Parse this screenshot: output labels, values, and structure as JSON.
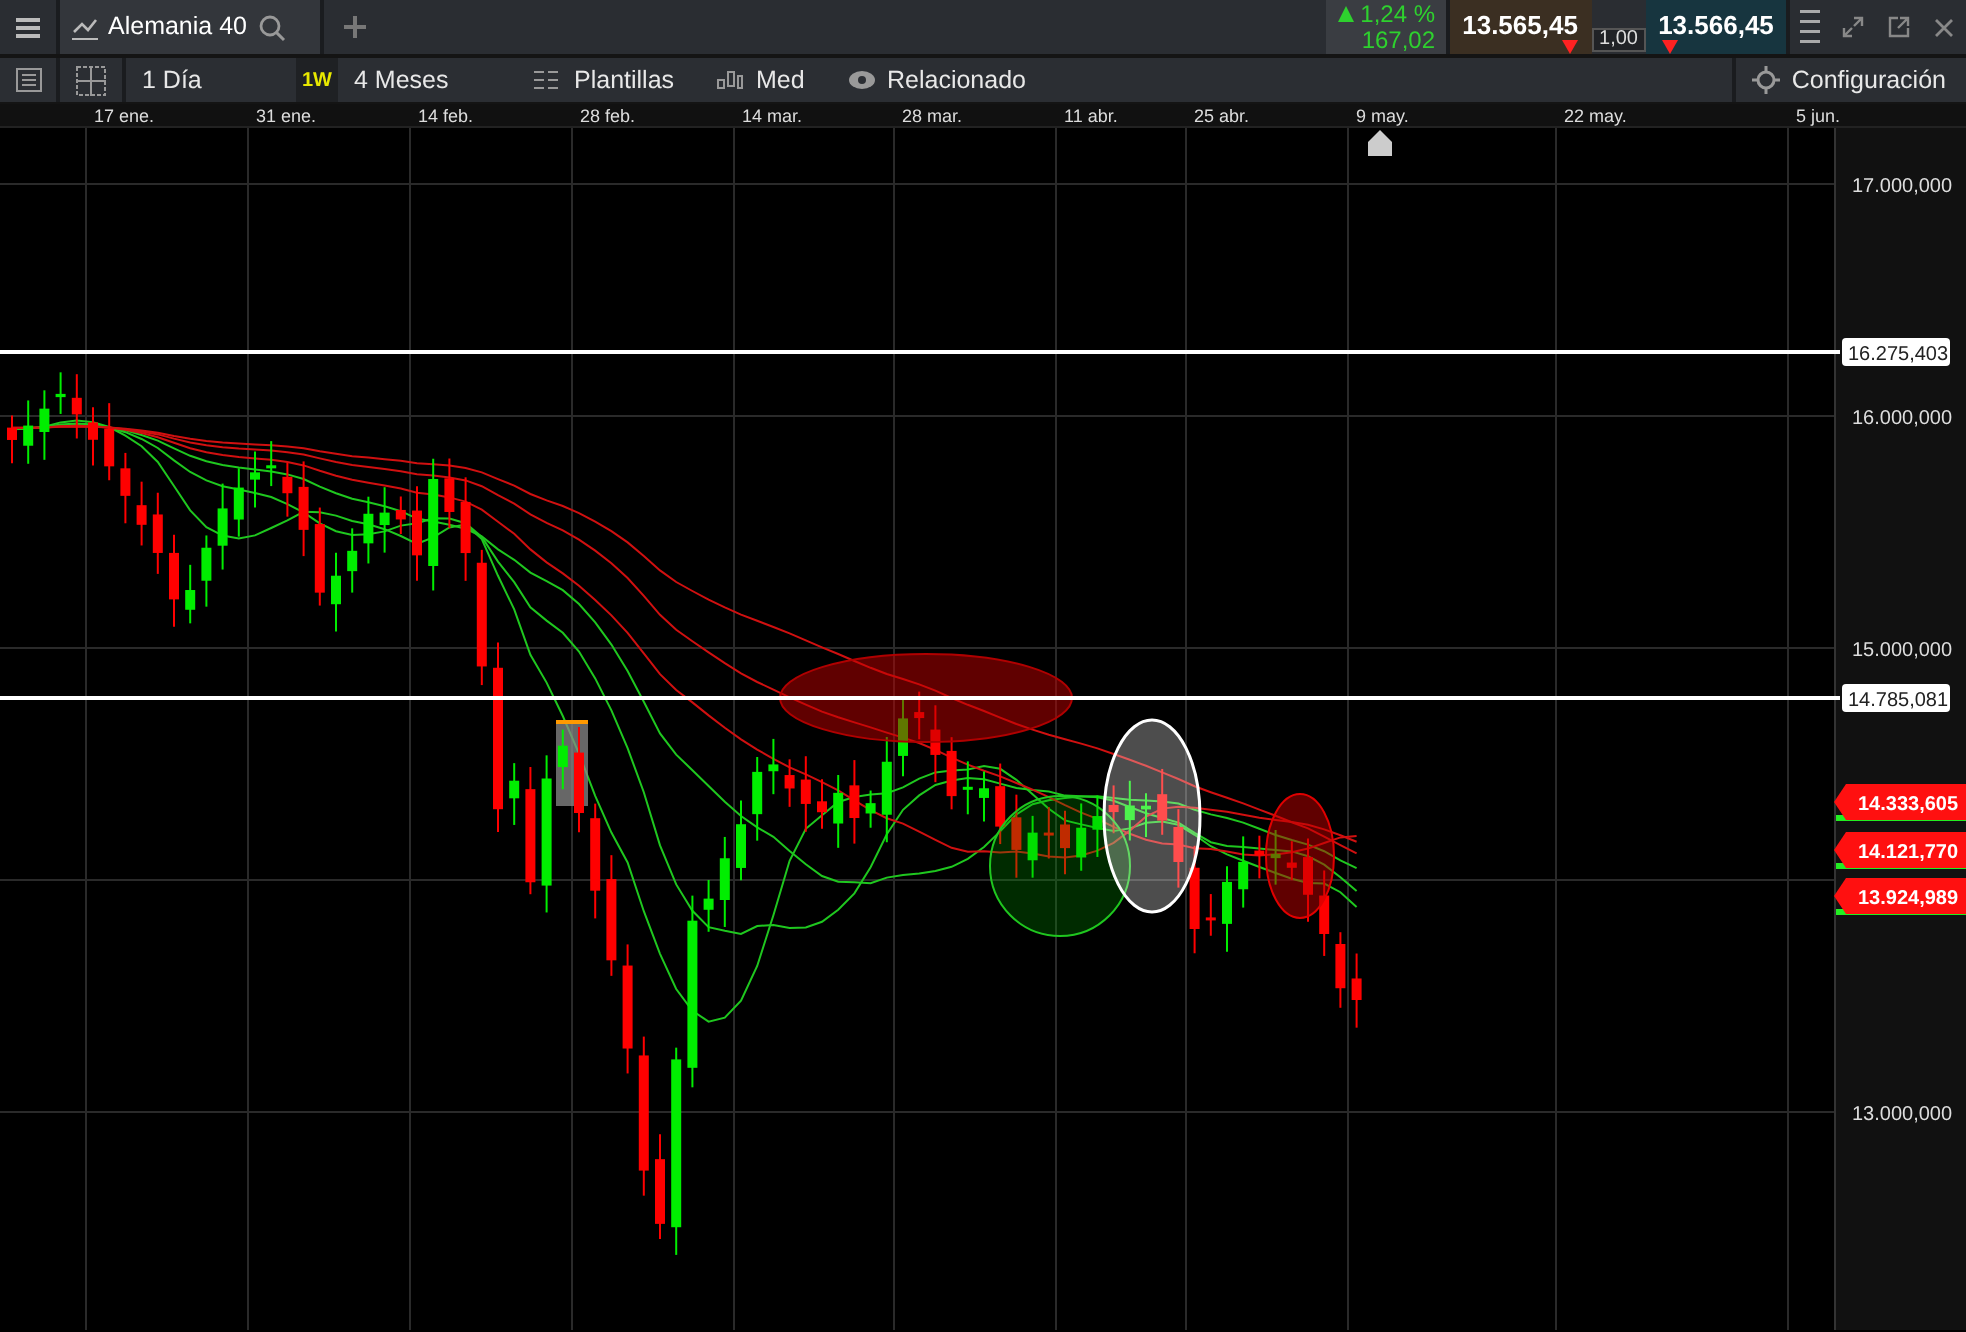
{
  "top_bar": {
    "instrument": "Alemania 40",
    "change_percent": "1,24 %",
    "change_points": "167,02",
    "sell_price": "13.565,45",
    "buy_price": "13.566,45",
    "spread": "1,00"
  },
  "toolbar": {
    "interval": "1 Día",
    "period_badge": "1W",
    "period": "4 Meses",
    "templates": "Plantillas",
    "measure": "Med",
    "related": "Relacionado",
    "settings": "Configuración"
  },
  "chart": {
    "date_labels": [
      "17 ene.",
      "31 ene.",
      "14 feb.",
      "28 feb.",
      "14 mar.",
      "28 mar.",
      "11 abr.",
      "25 abr.",
      "9 may.",
      "22 may.",
      "5 jun."
    ],
    "price_labels": [
      "17.000,000",
      "16.000,000",
      "15.000,000",
      "13.000,000"
    ],
    "levels": [
      "16.275,403",
      "14.785,081"
    ],
    "price_tags": [
      "14.333,605",
      "14.121,770",
      "13.924,989"
    ]
  }
}
